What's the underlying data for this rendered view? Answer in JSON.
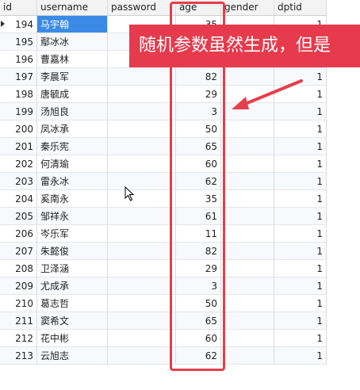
{
  "table": {
    "columns": [
      "id",
      "username",
      "password",
      "age",
      "gender",
      "dptid"
    ],
    "rows": [
      {
        "id": "194",
        "username": "马宇翰",
        "password": "",
        "age": "35",
        "gender": "",
        "dptid": "1"
      },
      {
        "id": "195",
        "username": "鄢冰冰",
        "password": "",
        "age": "",
        "gender": "",
        "dptid": "1"
      },
      {
        "id": "196",
        "username": "曹嘉林",
        "password": "",
        "age": "",
        "gender": "",
        "dptid": "1"
      },
      {
        "id": "197",
        "username": "李晨军",
        "password": "",
        "age": "82",
        "gender": "",
        "dptid": "1"
      },
      {
        "id": "198",
        "username": "唐毓成",
        "password": "",
        "age": "29",
        "gender": "",
        "dptid": "1"
      },
      {
        "id": "199",
        "username": "汤旭良",
        "password": "",
        "age": "3",
        "gender": "",
        "dptid": "1"
      },
      {
        "id": "200",
        "username": "凤冰承",
        "password": "",
        "age": "50",
        "gender": "",
        "dptid": "1"
      },
      {
        "id": "201",
        "username": "秦乐宪",
        "password": "",
        "age": "65",
        "gender": "",
        "dptid": "1"
      },
      {
        "id": "202",
        "username": "何清瑜",
        "password": "",
        "age": "60",
        "gender": "",
        "dptid": "1"
      },
      {
        "id": "203",
        "username": "雷永冰",
        "password": "",
        "age": "62",
        "gender": "",
        "dptid": "1"
      },
      {
        "id": "204",
        "username": "奚南永",
        "password": "",
        "age": "35",
        "gender": "",
        "dptid": "1"
      },
      {
        "id": "205",
        "username": "邹祥永",
        "password": "",
        "age": "61",
        "gender": "",
        "dptid": "1"
      },
      {
        "id": "206",
        "username": "岑乐军",
        "password": "",
        "age": "11",
        "gender": "",
        "dptid": "1"
      },
      {
        "id": "207",
        "username": "朱懿俊",
        "password": "",
        "age": "82",
        "gender": "",
        "dptid": "1"
      },
      {
        "id": "208",
        "username": "卫泽涵",
        "password": "",
        "age": "29",
        "gender": "",
        "dptid": "1"
      },
      {
        "id": "209",
        "username": "尤成承",
        "password": "",
        "age": "3",
        "gender": "",
        "dptid": "1"
      },
      {
        "id": "210",
        "username": "葛志哲",
        "password": "",
        "age": "50",
        "gender": "",
        "dptid": "1"
      },
      {
        "id": "211",
        "username": "窦希文",
        "password": "",
        "age": "65",
        "gender": "",
        "dptid": "1"
      },
      {
        "id": "212",
        "username": "花中彬",
        "password": "",
        "age": "60",
        "gender": "",
        "dptid": "1"
      },
      {
        "id": "213",
        "username": "云旭志",
        "password": "",
        "age": "62",
        "gender": "",
        "dptid": "1"
      }
    ]
  },
  "annotation": {
    "text": "随机参数虽然生成，但是",
    "color": "#e63a4d"
  },
  "icons": {
    "row_marker": "current-row-icon",
    "cursor": "mouse-cursor-icon",
    "arrow": "annotation-arrow-icon"
  }
}
